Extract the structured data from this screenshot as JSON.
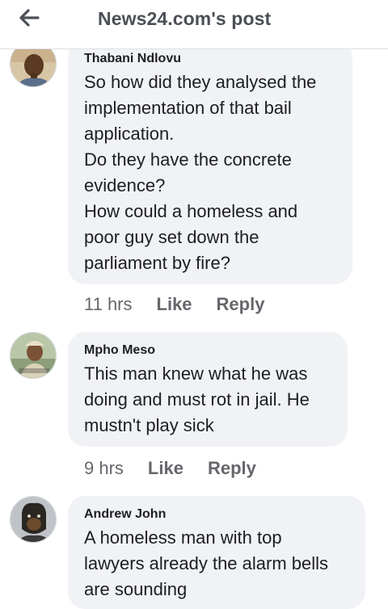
{
  "header": {
    "title": "News24.com's post",
    "back_icon": "arrow-left-icon"
  },
  "comments": [
    {
      "author": "Thabani Ndlovu",
      "text": "So how did they analysed the\nimplementation of that bail\napplication.\nDo they have the concrete\nevidence?\nHow could a homeless and\npoor guy set down the\nparliament by fire?",
      "time": "11 hrs",
      "like": "Like",
      "reply": "Reply"
    },
    {
      "author": "Mpho Meso",
      "text": "This man knew what he was\ndoing and must rot in jail. He\nmustn't play sick",
      "time": "9 hrs",
      "like": "Like",
      "reply": "Reply"
    },
    {
      "author": "Andrew John",
      "text": "A homeless man with top\nlawyers already the alarm bells\nare sounding",
      "time": "",
      "like": "",
      "reply": ""
    }
  ],
  "colors": {
    "bubble": "#f0f2f5",
    "meta_text": "#65676b",
    "title_text": "#4b4f56"
  }
}
